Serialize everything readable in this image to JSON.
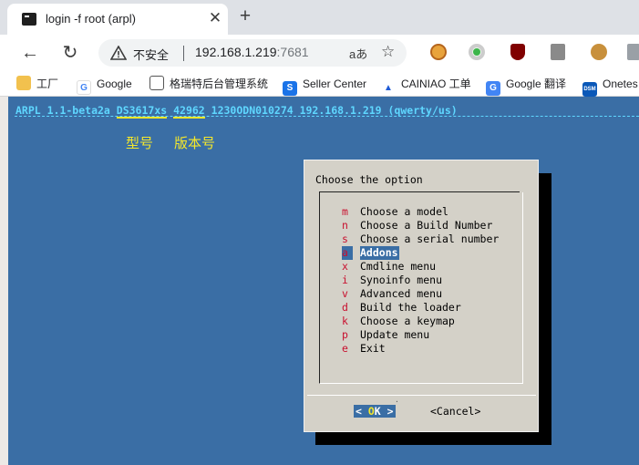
{
  "browser": {
    "tab_title": "login -f root (arpl)",
    "tab_close": "✕",
    "new_tab": "+",
    "back": "←",
    "reload": "↻",
    "not_secure": "不安全",
    "url_host": "192.168.1.219",
    "url_port": ":7681",
    "read_aloud": "aあ",
    "favorite": "☆",
    "bookmarks": [
      {
        "label": "工厂",
        "icon": "folder-icon"
      },
      {
        "label": "Google",
        "icon": "google-icon"
      },
      {
        "label": "格瑞特后台管理系统",
        "icon": "document-icon"
      },
      {
        "label": "Seller Center",
        "icon": "seller-center-icon"
      },
      {
        "label": "CAINIAO 工单",
        "icon": "cainiao-icon"
      },
      {
        "label": "Google 翻译",
        "icon": "google-translate-icon"
      },
      {
        "label": "Onetes",
        "icon": "dsm-icon"
      }
    ]
  },
  "terminal": {
    "header_prefix": "ARPL 1.1-beta2a ",
    "model": "DS3617xs",
    "build": "42962",
    "header_suffix": " 1230ODN010274 192.168.1.219 (qwerty/us)",
    "annotation_model": "型号",
    "annotation_build": "版本号"
  },
  "dialog": {
    "title": "Choose the option",
    "items": [
      {
        "key": "m",
        "label": "Choose a model"
      },
      {
        "key": "n",
        "label": "Choose a Build Number"
      },
      {
        "key": "s",
        "label": "Choose a serial number"
      },
      {
        "key": "a",
        "label": "Addons"
      },
      {
        "key": "x",
        "label": "Cmdline menu"
      },
      {
        "key": "i",
        "label": "Synoinfo menu"
      },
      {
        "key": "v",
        "label": "Advanced menu"
      },
      {
        "key": "d",
        "label": "Build the loader"
      },
      {
        "key": "k",
        "label": "Choose a keymap"
      },
      {
        "key": "p",
        "label": "Update menu"
      },
      {
        "key": "e",
        "label": "Exit"
      }
    ],
    "selected_index": 3,
    "ok_open": "< ",
    "ok_hot": "O",
    "ok_rest": "K",
    "ok_close": " >",
    "cancel_label": "<Cancel>"
  },
  "colors": {
    "terminal_bg": "#3a6ea5",
    "header_text": "#5fd7ff",
    "annotation": "#f5e82a",
    "dialog_bg": "#d4d1c8",
    "hotkey": "#c8102e"
  }
}
